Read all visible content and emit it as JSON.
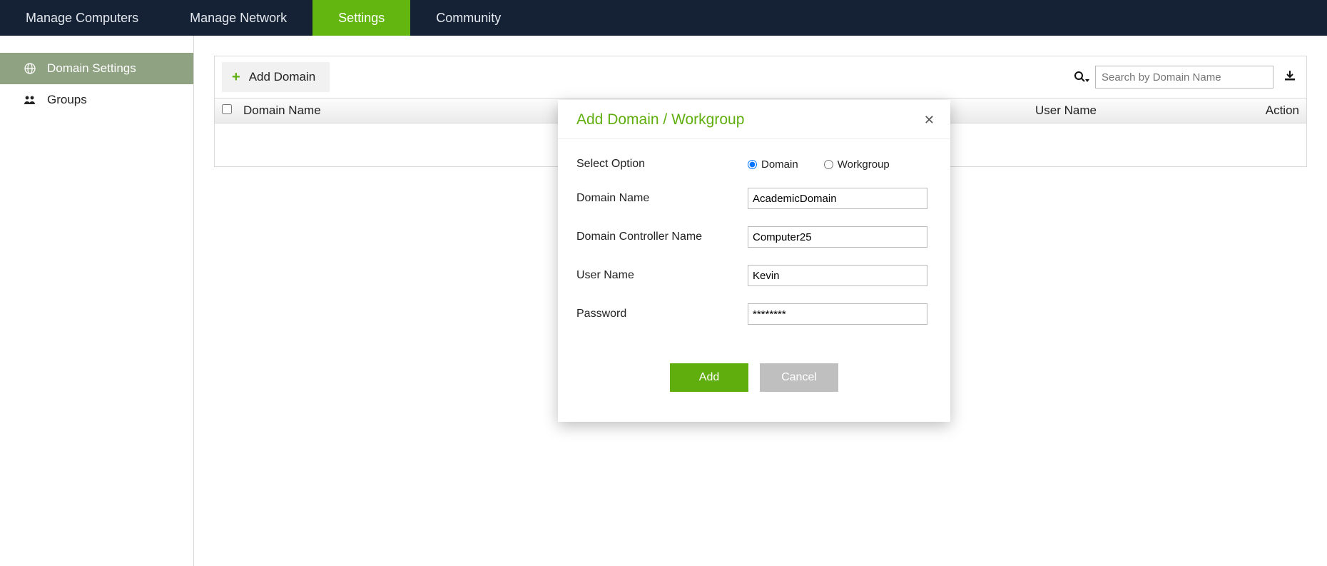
{
  "topnav": {
    "tabs": [
      {
        "label": "Manage Computers"
      },
      {
        "label": "Manage Network"
      },
      {
        "label": "Settings",
        "active": true
      },
      {
        "label": "Community"
      }
    ]
  },
  "sidebar": {
    "items": [
      {
        "label": "Domain Settings",
        "icon": "globe",
        "active": true
      },
      {
        "label": "Groups",
        "icon": "users"
      }
    ]
  },
  "toolbar": {
    "add_domain_label": "Add Domain",
    "search_placeholder": "Search by Domain Name"
  },
  "table": {
    "headers": {
      "domain": "Domain Name",
      "user": "User Name",
      "action": "Action"
    }
  },
  "modal": {
    "title": "Add Domain / Workgroup",
    "select_option_label": "Select Option",
    "option_domain": "Domain",
    "option_workgroup": "Workgroup",
    "selected_option": "domain",
    "domain_name_label": "Domain Name",
    "domain_name_value": "AcademicDomain",
    "controller_label": "Domain Controller Name",
    "controller_value": "Computer25",
    "user_label": "User Name",
    "user_value": "Kevin",
    "password_label": "Password",
    "password_value": "********",
    "add_btn": "Add",
    "cancel_btn": "Cancel"
  }
}
